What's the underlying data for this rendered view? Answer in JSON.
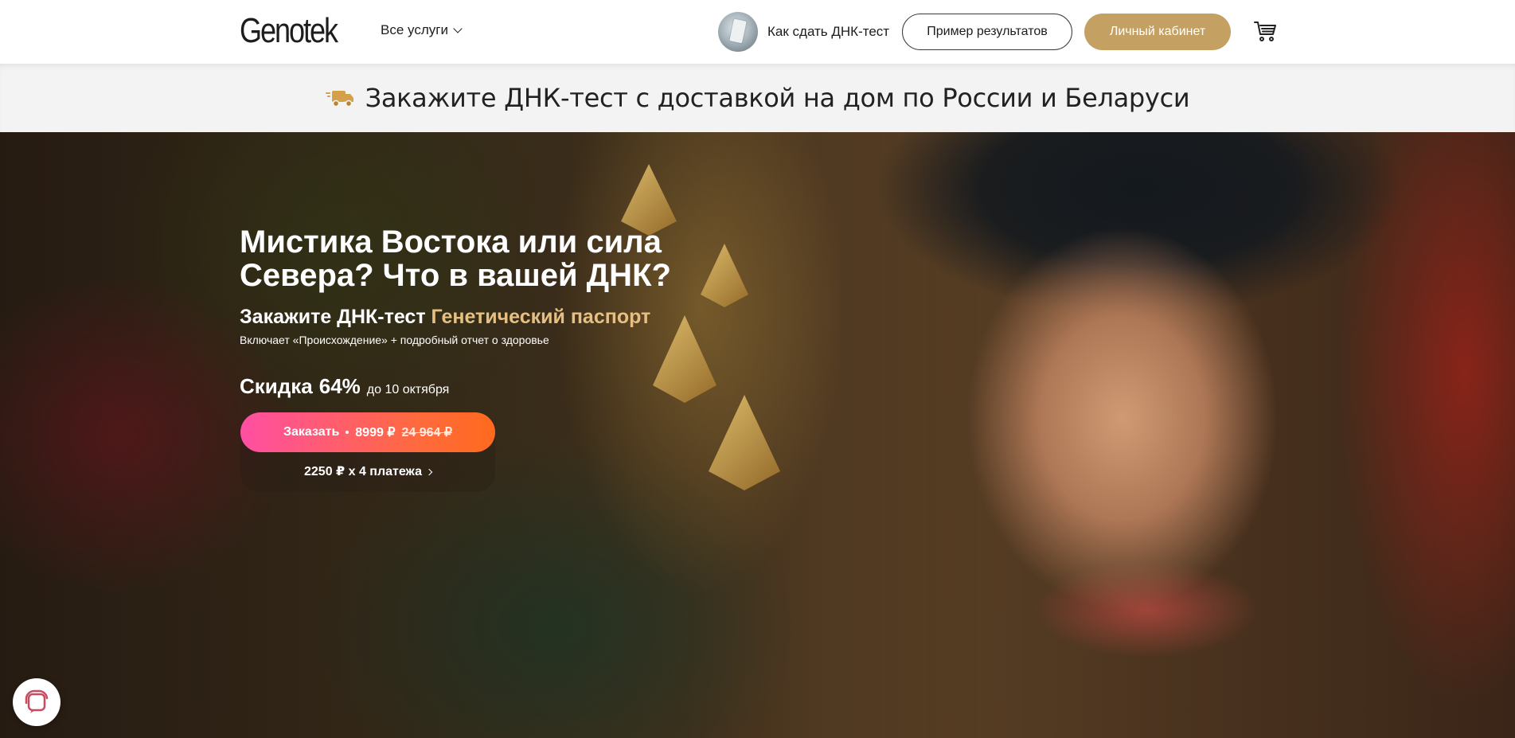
{
  "header": {
    "logo": "Genotek",
    "services_label": "Все услуги",
    "howto_label": "Как сдать ДНК-тест",
    "sample_button": "Пример результатов",
    "cabinet_button": "Личный кабинет",
    "cart_icon": "cart-icon"
  },
  "banner": {
    "text": "Закажите ДНК-тест с доставкой на дом по России и Беларуси",
    "icon": "truck-icon"
  },
  "hero": {
    "title": "Мистика Востока или сила Севера? Что в вашей ДНК?",
    "subtitle_prefix": "Закажите ДНК-тест",
    "subtitle_accent": "Генетический паспорт",
    "description": "Включает «Происхождение» + подробный отчет о здоровье",
    "discount_label": "Скидка",
    "discount_value": "64%",
    "discount_until": "до 10 октября",
    "order_label": "Заказать",
    "price": "8999 ₽",
    "old_price": "24 964 ₽",
    "installments": "2250 ₽ x 4 платежа"
  },
  "colors": {
    "accent_gold": "#c4a063",
    "accent_text": "#e6c082",
    "order_gradient_start": "#ff4fa3",
    "order_gradient_end": "#ff6a1e"
  }
}
